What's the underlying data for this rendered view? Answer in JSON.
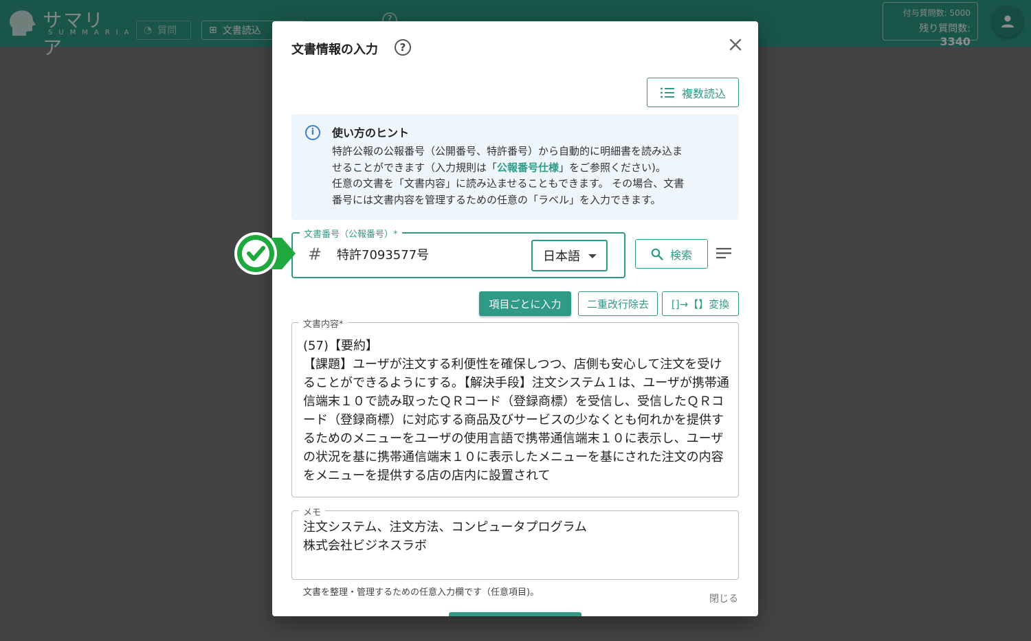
{
  "appbar": {
    "logo_text": "サマリア",
    "logo_sub": "SUMMARIA",
    "nav_question_label": "質問",
    "nav_doc_label": "文書読込",
    "quota_granted_label": "付与質問数: 5000",
    "quota_remaining_label": "残り質問数:",
    "quota_remaining_value": "3340"
  },
  "dialog": {
    "title": "文書情報の入力",
    "multi_load_label": "複数読込",
    "hint": {
      "title": "使い方のヒント",
      "line1": "特許公報の公報番号（公開番号、特許番号）から自動的に明細書を読み込ま",
      "line2_pre": "せることができます（入力規則は「",
      "line2_link": "公報番号仕様",
      "line2_post": "」をご参照ください)。",
      "line3": "任意の文書を「文書内容」に読み込ませることもできます。 その場合、文書",
      "line4": "番号には文書内容を管理するための任意の「ラベル」を入力できます。"
    },
    "doc_number": {
      "label": "文書番号（公報番号）*",
      "value": "特許7093577号",
      "language": "日本語"
    },
    "search_label": "検索",
    "tools": {
      "itemize_label": "項目ごとに入力",
      "remove_double_newline_label": "二重改行除去",
      "convert_brackets_label": "[]→【】変換"
    },
    "content": {
      "label": "文書内容*",
      "text": "(57)【要約】\n【課題】ユーザが注文する利便性を確保しつつ、店側も安心して注文を受けることができるようにする。【解決手段】注文システム１は、ユーザが携帯通信端末１０で読み取ったＱＲコード（登録商標）を受信し、受信したＱＲコード（登録商標）に対応する商品及びサービスの少なくとも何れかを提供するためのメニューをユーザの使用言語で携帯通信端末１０に表示し、ユーザの状況を基に携帯通信端末１０に表示したメニューを基にされた注文の内容をメニューを提供する店の店内に設置されて"
    },
    "memo": {
      "label": "メモ",
      "text": "注文システム、注文方法、コンピュータプログラム\n株式会社ビジネスラボ",
      "helper": "文書を整理・管理するための任意入力欄です（任意項目)。"
    },
    "close_label": "閉じる"
  },
  "colors": {
    "accent": "#2f9b86",
    "hint_bg": "#eef5fb",
    "info_blue": "#3b7fd1",
    "marker_green": "#1fa83e"
  },
  "icons": [
    "help-icon",
    "close-icon",
    "list-icon",
    "info-icon",
    "hash-icon",
    "search-icon",
    "menu-icon",
    "check-icon",
    "user-icon"
  ]
}
